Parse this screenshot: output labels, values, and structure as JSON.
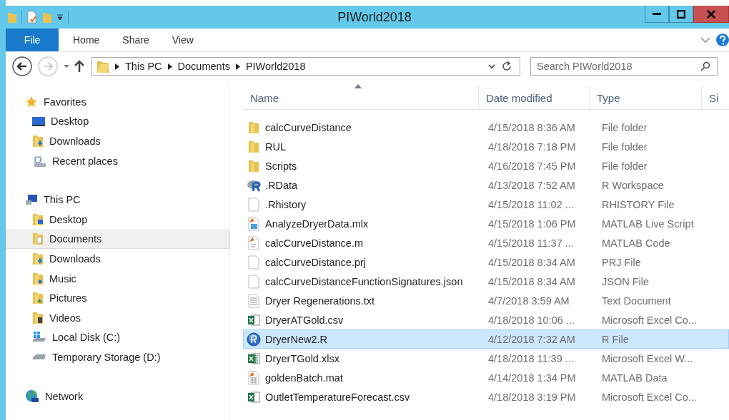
{
  "window": {
    "title": "PIWorld2018"
  },
  "ribbon": {
    "tabs": [
      {
        "label": "File",
        "selected": true
      },
      {
        "label": "Home",
        "selected": false
      },
      {
        "label": "Share",
        "selected": false
      },
      {
        "label": "View",
        "selected": false
      }
    ]
  },
  "address": {
    "path": [
      "This PC",
      "Documents",
      "PIWorld2018"
    ]
  },
  "search": {
    "placeholder": "Search PIWorld2018"
  },
  "sidebar": {
    "groups": [
      {
        "label": "Favorites",
        "kind": "star",
        "children": [
          {
            "label": "Desktop",
            "kind": "desktop",
            "selected": false
          },
          {
            "label": "Downloads",
            "kind": "downloads",
            "selected": false
          },
          {
            "label": "Recent places",
            "kind": "recent",
            "selected": false
          }
        ]
      },
      {
        "label": "This PC",
        "kind": "pc",
        "children": [
          {
            "label": "Desktop",
            "kind": "folder-desktop",
            "selected": false
          },
          {
            "label": "Documents",
            "kind": "documents",
            "selected": true
          },
          {
            "label": "Downloads",
            "kind": "downloads",
            "selected": false
          },
          {
            "label": "Music",
            "kind": "music",
            "selected": false
          },
          {
            "label": "Pictures",
            "kind": "pictures",
            "selected": false
          },
          {
            "label": "Videos",
            "kind": "videos",
            "selected": false
          },
          {
            "label": "Local Disk (C:)",
            "kind": "disk-c",
            "selected": false
          },
          {
            "label": "Temporary Storage (D:)",
            "kind": "disk",
            "selected": false
          }
        ]
      },
      {
        "label": "Network",
        "kind": "network"
      }
    ]
  },
  "table": {
    "columns": [
      "Name",
      "Date modified",
      "Type",
      "Si"
    ],
    "rows": [
      {
        "name": "calcCurveDistance",
        "date": "4/15/2018 8:36 AM",
        "type": "File folder",
        "kind": "folder",
        "selected": false
      },
      {
        "name": "RUL",
        "date": "4/18/2018 7:18 PM",
        "type": "File folder",
        "kind": "folder",
        "selected": false
      },
      {
        "name": "Scripts",
        "date": "4/16/2018 7:45 PM",
        "type": "File folder",
        "kind": "folder",
        "selected": false
      },
      {
        "name": ".RData",
        "date": "4/13/2018 7:52 AM",
        "type": "R Workspace",
        "kind": "rdata",
        "selected": false
      },
      {
        "name": ".Rhistory",
        "date": "4/15/2018 11:02 ...",
        "type": "RHISTORY File",
        "kind": "blank",
        "selected": false
      },
      {
        "name": "AnalyzeDryerData.mlx",
        "date": "4/15/2018 1:06 PM",
        "type": "MATLAB Live Script",
        "kind": "mlx",
        "selected": false
      },
      {
        "name": "calcCurveDistance.m",
        "date": "4/15/2018 11:37 ...",
        "type": "MATLAB Code",
        "kind": "mcode",
        "selected": false
      },
      {
        "name": "calcCurveDistance.prj",
        "date": "4/15/2018 8:34 AM",
        "type": "PRJ File",
        "kind": "blank",
        "selected": false
      },
      {
        "name": "calcCurveDistanceFunctionSignatures.json",
        "date": "4/15/2018 8:34 AM",
        "type": "JSON File",
        "kind": "blank",
        "selected": false
      },
      {
        "name": "Dryer Regenerations.txt",
        "date": "4/7/2018 3:59 AM",
        "type": "Text Document",
        "kind": "text",
        "selected": false
      },
      {
        "name": "DryerATGold.csv",
        "date": "4/18/2018 10:06 ...",
        "type": "Microsoft Excel Co...",
        "kind": "csv",
        "selected": false
      },
      {
        "name": "DryerNew2.R",
        "date": "4/12/2018 7:32 AM",
        "type": "R File",
        "kind": "rfile",
        "selected": true
      },
      {
        "name": "DryerTGold.xlsx",
        "date": "4/18/2018 11:39 ...",
        "type": "Microsoft Excel W...",
        "kind": "xlsx",
        "selected": false
      },
      {
        "name": "goldenBatch.mat",
        "date": "4/14/2018 1:34 PM",
        "type": "MATLAB Data",
        "kind": "mat",
        "selected": false
      },
      {
        "name": "OutletTemperatureForecast.csv",
        "date": "4/18/2018 3:19 PM",
        "type": "Microsoft Excel Co...",
        "kind": "csv",
        "selected": false
      }
    ]
  }
}
